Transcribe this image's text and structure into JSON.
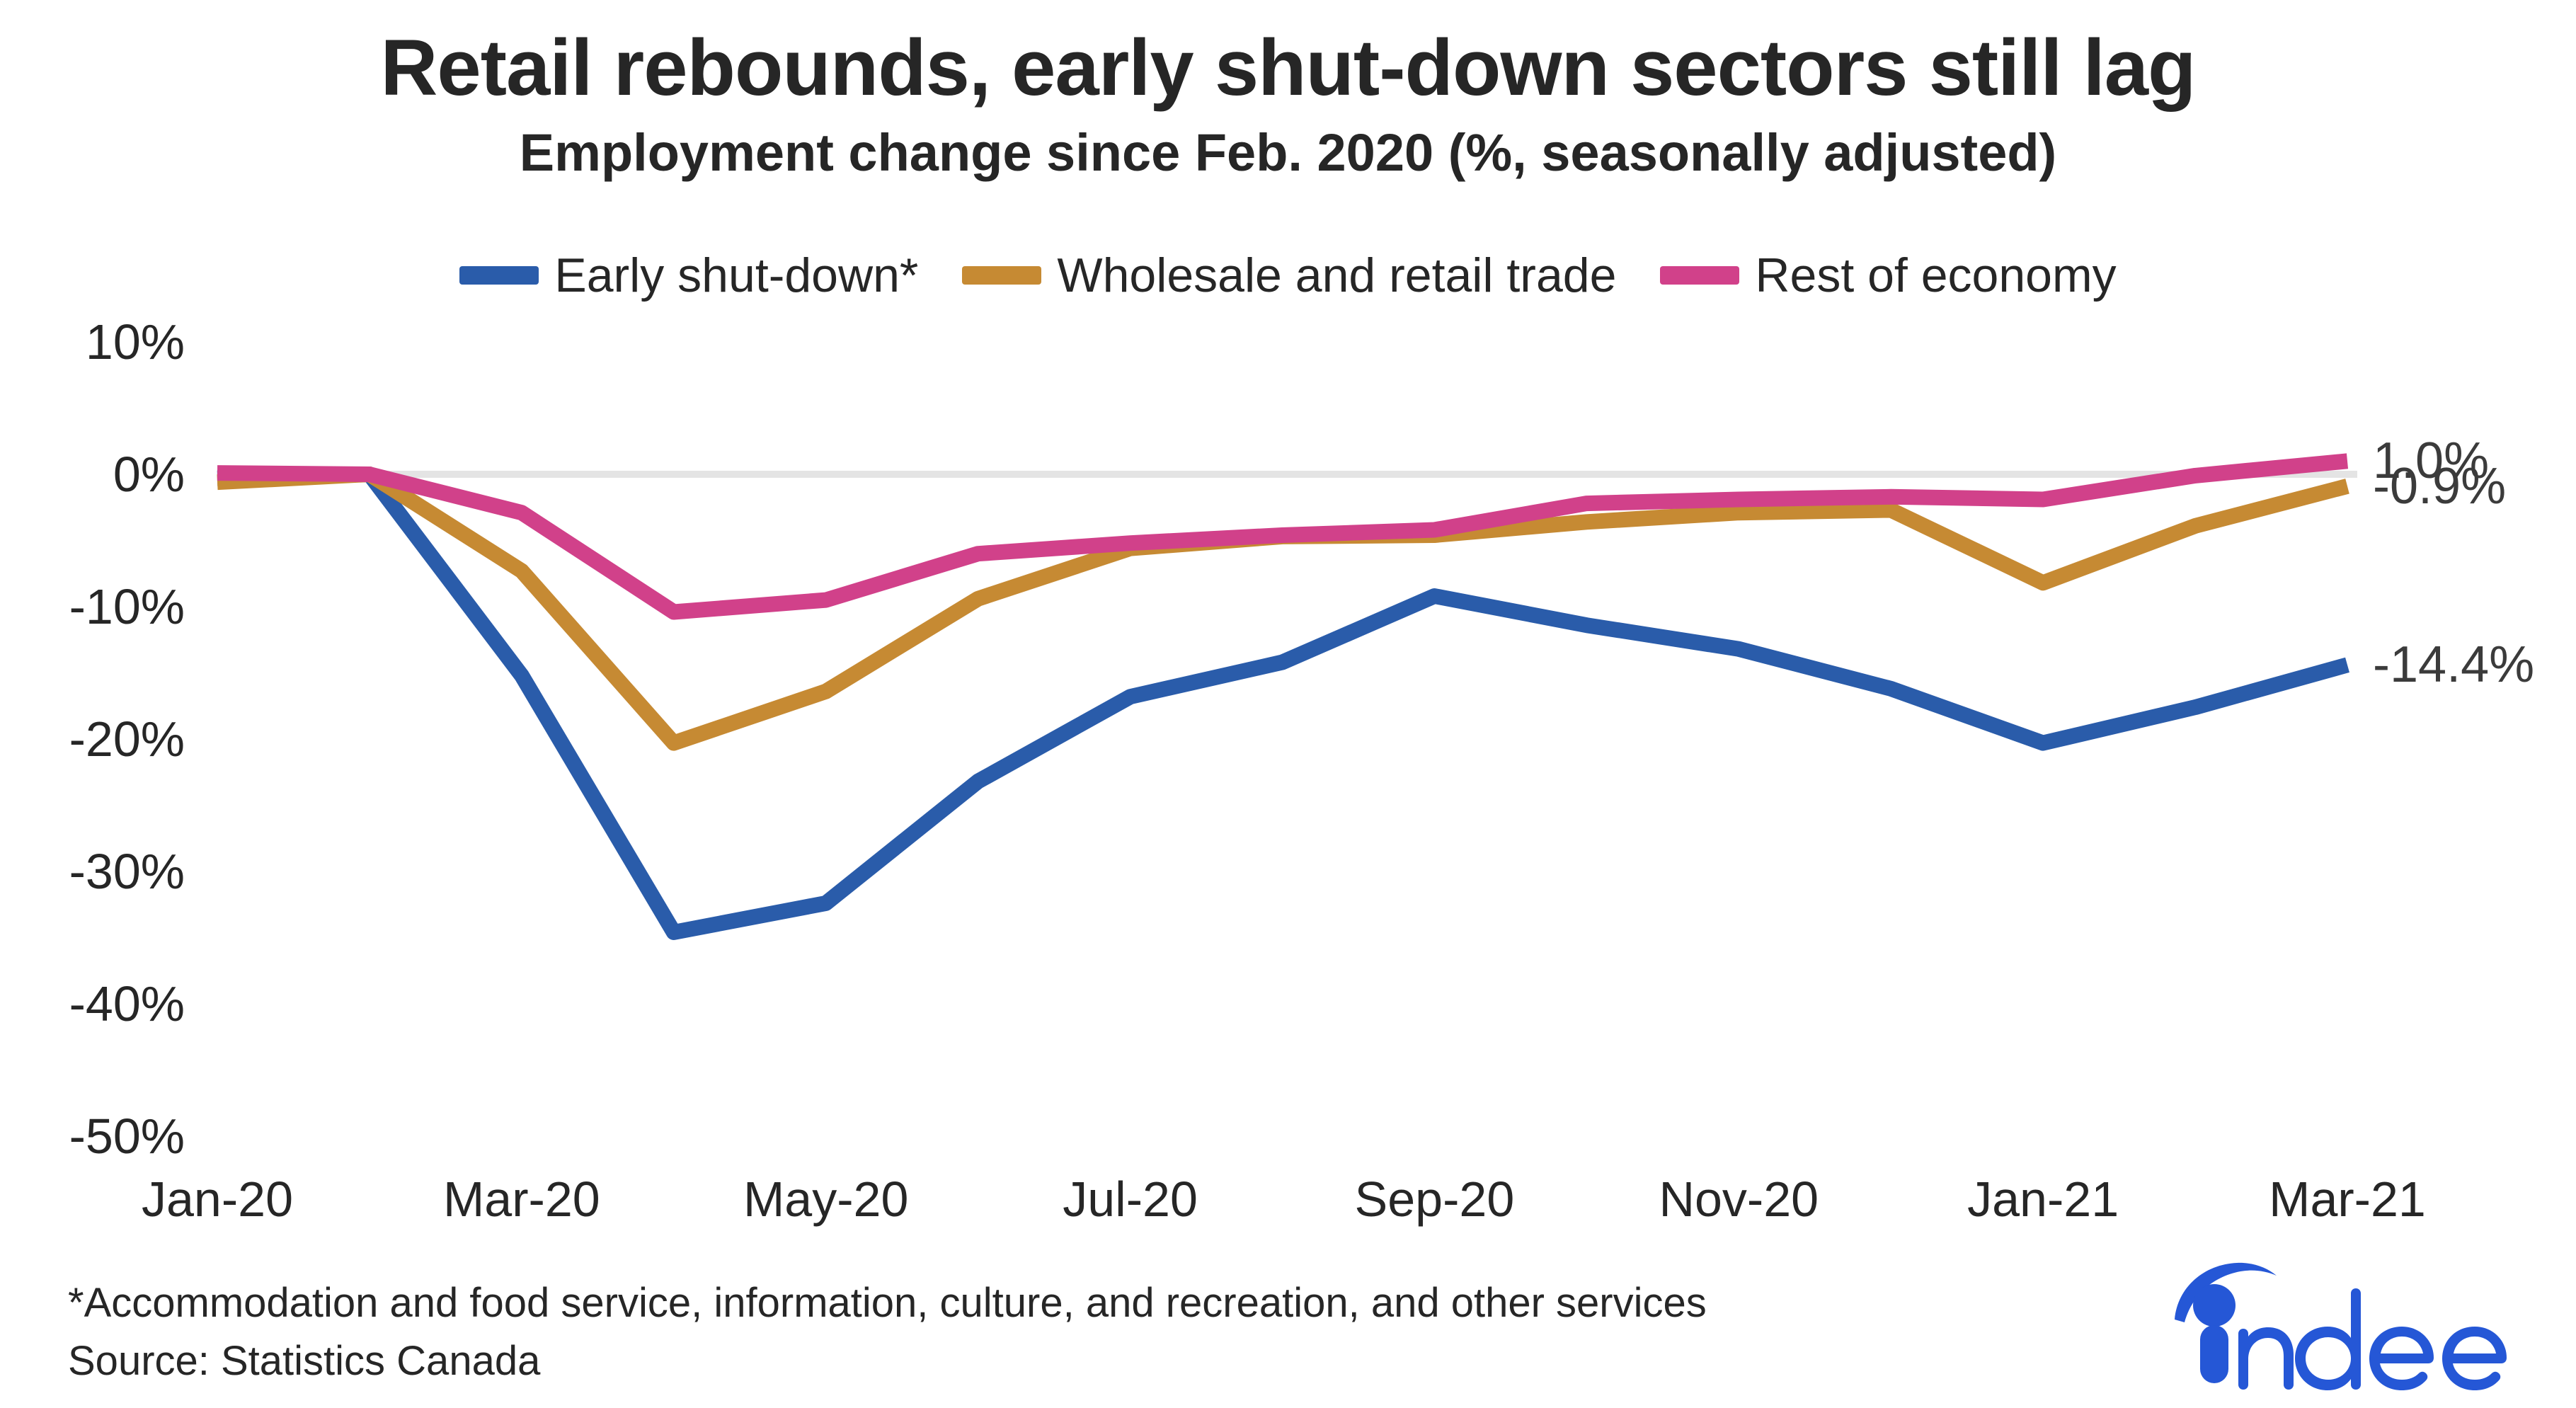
{
  "header": {
    "title": "Retail rebounds, early shut-down sectors still lag",
    "subtitle": "Employment change since Feb. 2020 (%, seasonally adjusted)"
  },
  "footer": {
    "footnote": "*Accommodation and food service, information, culture, and recreation, and other services",
    "source": "Source: Statistics Canada"
  },
  "logo": {
    "name": "indeed-logo",
    "text": "indeed",
    "color": "#2557D6"
  },
  "colors": {
    "early_shutdown": "#2a5caa",
    "wholesale_retail": "#c68a33",
    "rest_of_economy": "#d1418a",
    "gridline": "#e4e4e4",
    "text": "#262626"
  },
  "chart_data": {
    "type": "line",
    "title": "Retail rebounds, early shut-down sectors still lag",
    "subtitle": "Employment change since Feb. 2020 (%, seasonally adjusted)",
    "xlabel": "",
    "ylabel": "",
    "ylim": [
      -50,
      10
    ],
    "yticks": [
      10,
      0,
      -10,
      -20,
      -30,
      -40,
      -50
    ],
    "ytick_labels": [
      "10%",
      "0%",
      "-10%",
      "-20%",
      "-30%",
      "-40%",
      "-50%"
    ],
    "grid": false,
    "zero_line": true,
    "legend_position": "top-center",
    "x": [
      "Jan-20",
      "Feb-20",
      "Mar-20",
      "Apr-20",
      "May-20",
      "Jun-20",
      "Jul-20",
      "Aug-20",
      "Sep-20",
      "Oct-20",
      "Nov-20",
      "Dec-20",
      "Jan-21",
      "Feb-21",
      "Mar-21"
    ],
    "xtick_labels": [
      "Jan-20",
      "Mar-20",
      "May-20",
      "Jul-20",
      "Sep-20",
      "Nov-20",
      "Jan-21",
      "Mar-21"
    ],
    "xtick_indices": [
      0,
      2,
      4,
      6,
      8,
      10,
      12,
      14
    ],
    "series": [
      {
        "name": "Early shut-down*",
        "color": "#2a5caa",
        "values": [
          -0.3,
          0.0,
          -15.2,
          -34.6,
          -32.4,
          -23.2,
          -16.8,
          -14.2,
          -9.2,
          -11.4,
          -13.2,
          -16.2,
          -20.3,
          -17.6,
          -14.4
        ],
        "end_label": "-14.4%"
      },
      {
        "name": "Wholesale and retail trade",
        "color": "#c68a33",
        "values": [
          -0.6,
          0.0,
          -7.3,
          -20.3,
          -16.4,
          -9.4,
          -5.6,
          -4.7,
          -4.6,
          -3.6,
          -2.9,
          -2.7,
          -8.2,
          -3.9,
          -0.9
        ],
        "end_label": "-0.9%"
      },
      {
        "name": "Rest of economy",
        "color": "#d1418a",
        "values": [
          0.1,
          0.0,
          -2.9,
          -10.4,
          -9.5,
          -6.0,
          -5.2,
          -4.6,
          -4.2,
          -2.2,
          -1.9,
          -1.7,
          -1.9,
          -0.1,
          1.0
        ],
        "end_label": "1.0%"
      }
    ],
    "end_labels": [
      {
        "text": "1.0%",
        "value": 1.0,
        "series": "Rest of economy"
      },
      {
        "text": "-0.9%",
        "value": -0.9,
        "series": "Wholesale and retail trade"
      },
      {
        "text": "-14.4%",
        "value": -14.4,
        "series": "Early shut-down*"
      }
    ]
  }
}
